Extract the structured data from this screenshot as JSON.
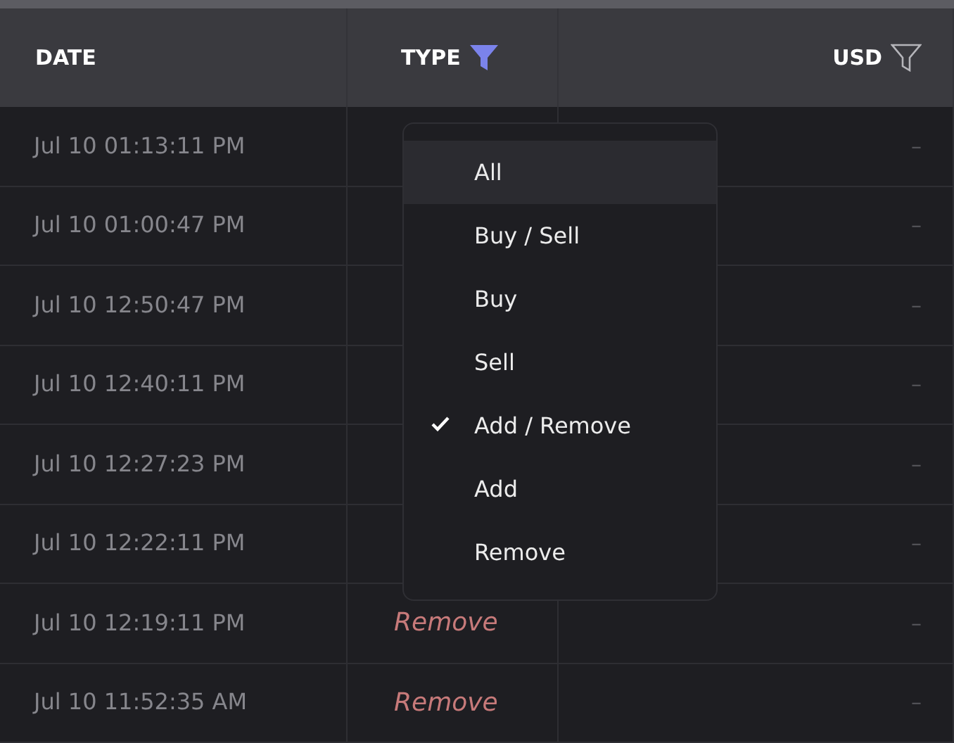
{
  "columns": [
    {
      "label": "DATE"
    },
    {
      "label": "TYPE",
      "filter_active": true
    },
    {
      "label": "USD",
      "filter_active": false
    }
  ],
  "rows": [
    {
      "date": "Jul 10 01:13:11 PM",
      "type": "",
      "usd": "–"
    },
    {
      "date": "Jul 10 01:00:47 PM",
      "type": "",
      "usd": "–"
    },
    {
      "date": "Jul 10 12:50:47 PM",
      "type": "",
      "usd": "–"
    },
    {
      "date": "Jul 10 12:40:11 PM",
      "type": "",
      "usd": "–"
    },
    {
      "date": "Jul 10 12:27:23 PM",
      "type": "",
      "usd": "–"
    },
    {
      "date": "Jul 10 12:22:11 PM",
      "type": "",
      "usd": "–"
    },
    {
      "date": "Jul 10 12:19:11 PM",
      "type": "Remove",
      "usd": "–"
    },
    {
      "date": "Jul 10 11:52:35 AM",
      "type": "Remove",
      "usd": "–"
    }
  ],
  "type_filter_menu": {
    "items": [
      {
        "label": "All",
        "checked": false,
        "hovered": true
      },
      {
        "label": "Buy / Sell",
        "checked": false,
        "hovered": false
      },
      {
        "label": "Buy",
        "checked": false,
        "hovered": false
      },
      {
        "label": "Sell",
        "checked": false,
        "hovered": false
      },
      {
        "label": "Add / Remove",
        "checked": true,
        "hovered": false
      },
      {
        "label": "Add",
        "checked": false,
        "hovered": false
      },
      {
        "label": "Remove",
        "checked": false,
        "hovered": false
      }
    ]
  }
}
